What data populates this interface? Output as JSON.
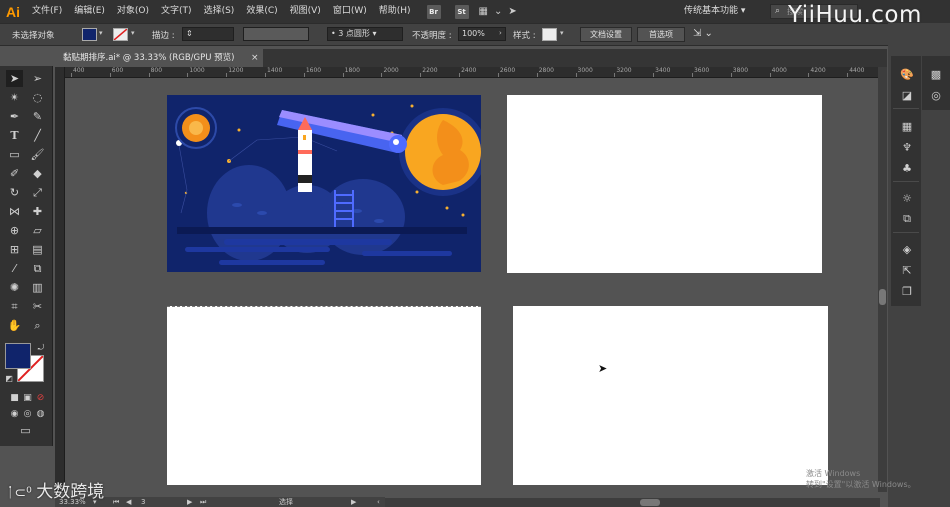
{
  "app": {
    "logo_text": "Ai"
  },
  "menu": {
    "items": [
      "文件(F)",
      "编辑(E)",
      "对象(O)",
      "文字(T)",
      "选择(S)",
      "效果(C)",
      "视图(V)",
      "窗口(W)",
      "帮助(H)"
    ],
    "bridge_label": "Br",
    "stock_label": "St",
    "workspace": "传统基本功能",
    "search_placeholder": "搜索"
  },
  "control_bar": {
    "selection_status": "未选择对象",
    "fill_color": "#10246b",
    "stroke_label": "描边 :",
    "brush_label": "3 点圆形",
    "opacity_label": "不透明度 :",
    "opacity_value": "100%",
    "style_label": "样式 :",
    "doc_setup_button": "文档设置",
    "preferences_button": "首选项"
  },
  "document": {
    "tab_title": "黏贴期排序.ai* @ 33.33% (RGB/GPU 预览)",
    "tab_close": "×"
  },
  "ruler": {
    "top_labels": [
      "400",
      "600",
      "800",
      "1000",
      "1200",
      "1400",
      "1600",
      "1800",
      "2000",
      "2200",
      "2400",
      "2600",
      "2800",
      "3000",
      "3200",
      "3400",
      "3600",
      "3800",
      "4000",
      "4200",
      "4400"
    ]
  },
  "toolbar": {
    "fill_color": "#10246b",
    "stroke_color": "#ffffff"
  },
  "illustration": {
    "background": "#10246b",
    "moon_color": "#f9a620",
    "planet_color": "#f38f1a",
    "hill_color": "#20388f",
    "comet_color": "#4f6bff"
  },
  "status_bar": {
    "zoom": "33.33%",
    "artboard_number": "3",
    "mode": "选择"
  },
  "os": {
    "activate_line1": "激活 Windows",
    "activate_line2": "转到\"设置\"以激活 Windows。"
  },
  "watermark": {
    "top": "YiiHuu.com",
    "bottom": "大数跨境"
  }
}
